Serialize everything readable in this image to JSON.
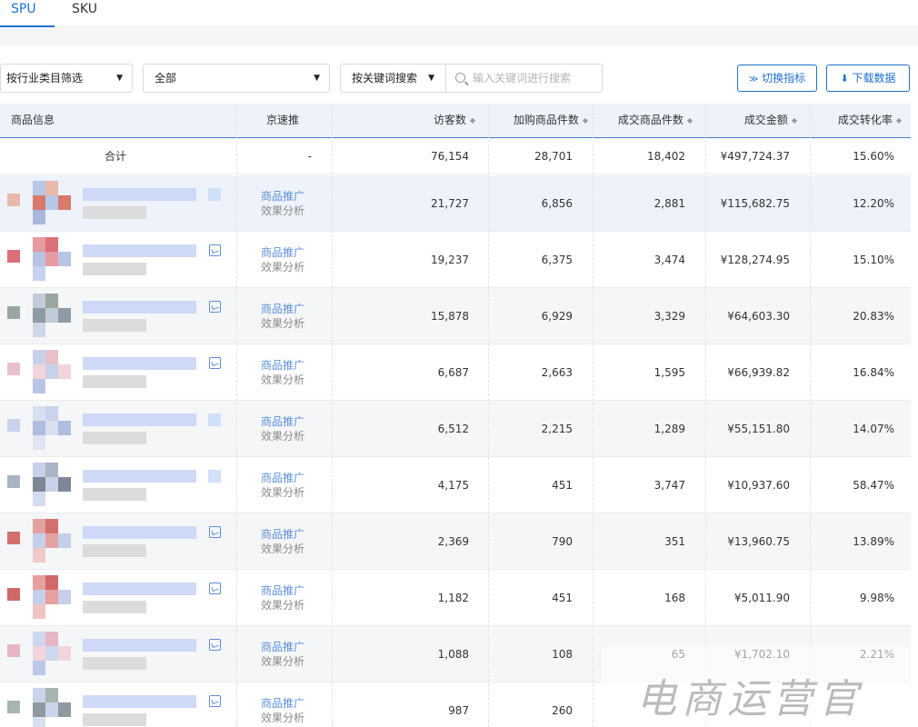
{
  "tabs": [
    {
      "label": "SPU",
      "active": true
    },
    {
      "label": "SKU",
      "active": false
    }
  ],
  "filters": {
    "category_select": "按行业类目筛选",
    "scope_select": "全部",
    "search_type_select": "按关键词搜索",
    "search_placeholder": "输入关键词进行搜索",
    "switch_metrics_label": "切换指标",
    "download_label": "下载数据"
  },
  "table": {
    "columns": [
      "商品信息",
      "京速推",
      "访客数",
      "加购商品件数",
      "成交商品件数",
      "成交金额",
      "成交转化率"
    ],
    "total": {
      "label": "合计",
      "jingsutui": "-",
      "visitors": "76,154",
      "add_to_cart": "28,701",
      "deal_items": "18,402",
      "deal_amount": "¥497,724.37",
      "conversion": "15.60%"
    },
    "promo_line1": "商品推广",
    "promo_line2": "效果分析",
    "rows": [
      {
        "visitors": "21,727",
        "add_to_cart": "6,856",
        "deal_items": "2,881",
        "deal_amount": "¥115,682.75",
        "conversion": "12.20%"
      },
      {
        "visitors": "19,237",
        "add_to_cart": "6,375",
        "deal_items": "3,474",
        "deal_amount": "¥128,274.95",
        "conversion": "15.10%"
      },
      {
        "visitors": "15,878",
        "add_to_cart": "6,929",
        "deal_items": "3,329",
        "deal_amount": "¥64,603.30",
        "conversion": "20.83%"
      },
      {
        "visitors": "6,687",
        "add_to_cart": "2,663",
        "deal_items": "1,595",
        "deal_amount": "¥66,939.82",
        "conversion": "16.84%"
      },
      {
        "visitors": "6,512",
        "add_to_cart": "2,215",
        "deal_items": "1,289",
        "deal_amount": "¥55,151.80",
        "conversion": "14.07%"
      },
      {
        "visitors": "4,175",
        "add_to_cart": "451",
        "deal_items": "3,747",
        "deal_amount": "¥10,937.60",
        "conversion": "58.47%"
      },
      {
        "visitors": "2,369",
        "add_to_cart": "790",
        "deal_items": "351",
        "deal_amount": "¥13,960.75",
        "conversion": "13.89%"
      },
      {
        "visitors": "1,182",
        "add_to_cart": "451",
        "deal_items": "168",
        "deal_amount": "¥5,011.90",
        "conversion": "9.98%"
      },
      {
        "visitors": "1,088",
        "add_to_cart": "108",
        "deal_items": "65",
        "deal_amount": "¥1,702.10",
        "conversion": "2.21%"
      },
      {
        "visitors": "987",
        "add_to_cart": "260",
        "deal_items": "",
        "deal_amount": "",
        "conversion": ""
      }
    ]
  },
  "watermark": "电商运营官",
  "colors": {
    "accent": "#1f6fd4",
    "header_bg": "#eef3fb",
    "link": "#5b8fd9"
  }
}
